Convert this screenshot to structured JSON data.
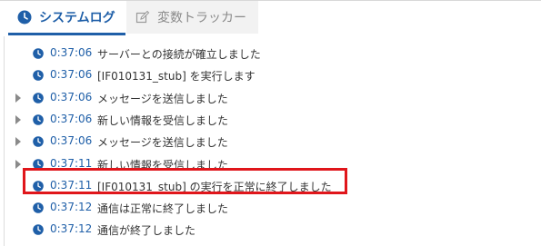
{
  "colors": {
    "accent": "#1f5fa8",
    "highlight": "#e0161b"
  },
  "tabs": {
    "active": {
      "label": "システムログ",
      "icon": "clock-icon"
    },
    "inactive": {
      "label": "変数トラッカー",
      "icon": "edit-icon"
    }
  },
  "log": [
    {
      "time": "0:37:06",
      "message": "サーバーとの接続が確立しました",
      "expandable": false
    },
    {
      "time": "0:37:06",
      "message": "[IF010131_stub] を実行します",
      "expandable": false
    },
    {
      "time": "0:37:06",
      "message": "メッセージを送信しました",
      "expandable": true
    },
    {
      "time": "0:37:06",
      "message": "新しい情報を受信しました",
      "expandable": true
    },
    {
      "time": "0:37:06",
      "message": "メッセージを送信しました",
      "expandable": true
    },
    {
      "time": "0:37:11",
      "message": "新しい情報を受信しました",
      "expandable": true
    },
    {
      "time": "0:37:11",
      "message": "[IF010131_stub] の実行を正常に終了しました",
      "expandable": false,
      "highlighted": true
    },
    {
      "time": "0:37:12",
      "message": "通信は正常に終了しました",
      "expandable": false
    },
    {
      "time": "0:37:12",
      "message": "通信が終了しました",
      "expandable": false
    }
  ]
}
